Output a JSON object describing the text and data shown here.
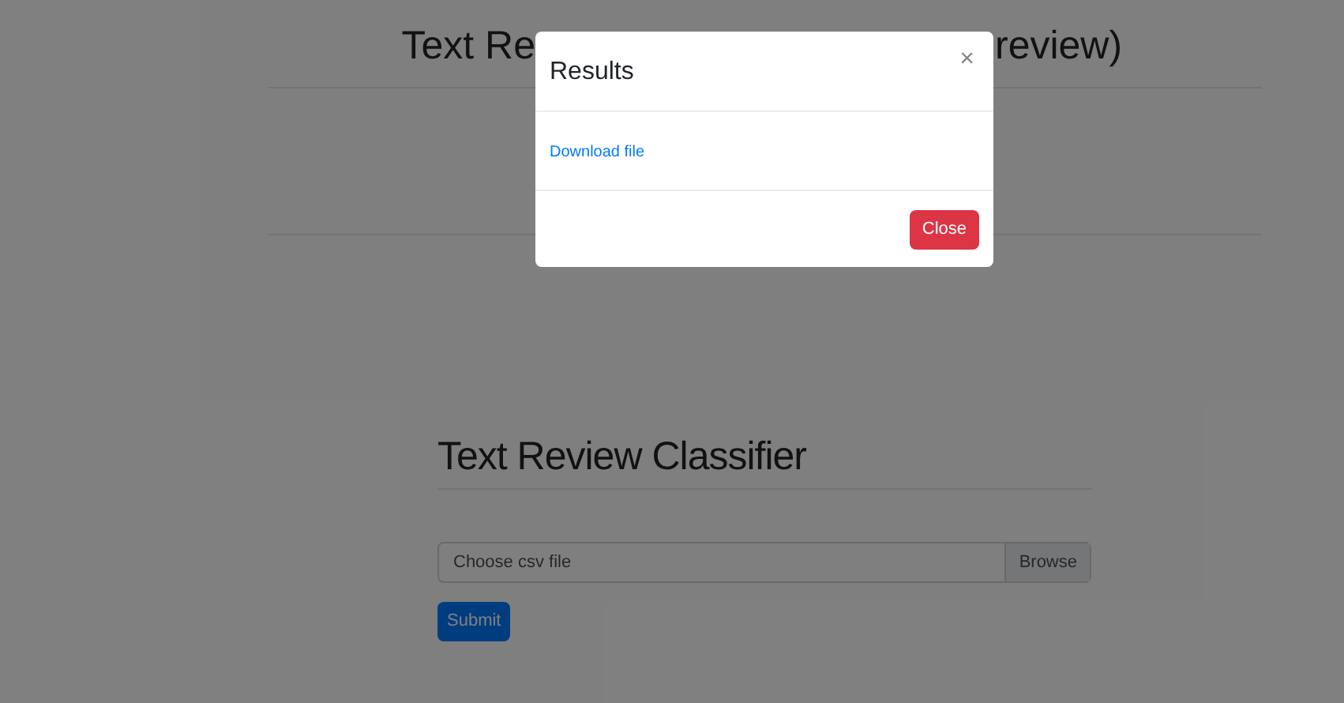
{
  "page": {
    "title_parts": [
      "Text Re",
      "review)"
    ],
    "heading": "Text Review Classifier",
    "file_input": {
      "label": "Choose csv file",
      "button": "Browse"
    },
    "submit": "Submit"
  },
  "modal": {
    "title": "Results",
    "close_icon": "×",
    "link": "Download file",
    "button": "Close"
  }
}
